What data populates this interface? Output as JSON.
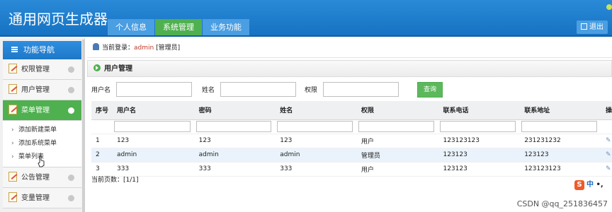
{
  "header": {
    "title": "通用网页生成器",
    "tabs": [
      {
        "label": "个人信息",
        "active": false
      },
      {
        "label": "系统管理",
        "active": true
      },
      {
        "label": "业务功能",
        "active": false
      }
    ],
    "logout_label": "退出"
  },
  "sidebar": {
    "title": "功能导航",
    "items": [
      {
        "label": "权限管理"
      },
      {
        "label": "用户管理"
      },
      {
        "label": "菜单管理",
        "active": true
      }
    ],
    "submenu": [
      "添加新建菜单",
      "添加系统菜单",
      "菜单列表"
    ],
    "items_after": [
      {
        "label": "公告管理"
      },
      {
        "label": "变量管理"
      }
    ]
  },
  "login": {
    "prefix": "当前登录：",
    "user": "admin",
    "role": "[管理员]"
  },
  "panel": {
    "title": "用户管理"
  },
  "search": {
    "username_label": "用户名",
    "name_label": "姓名",
    "perm_label": "权限",
    "button": "查询"
  },
  "table": {
    "headers": [
      "序号",
      "用户名",
      "密码",
      "姓名",
      "权限",
      "联系电话",
      "联系地址",
      "操"
    ],
    "rows": [
      [
        "1",
        "123",
        "123",
        "123",
        "用户",
        "123123123",
        "231231232"
      ],
      [
        "2",
        "admin",
        "admin",
        "admin",
        "管理员",
        "123123",
        "123123"
      ],
      [
        "3",
        "333",
        "333",
        "333",
        "用户",
        "123123",
        "123123123"
      ]
    ]
  },
  "pager": "当前页数：[1/1]",
  "ime": {
    "s": "S",
    "mode": "中",
    "extra": "•,"
  },
  "watermark": "CSDN @qq_251836457"
}
